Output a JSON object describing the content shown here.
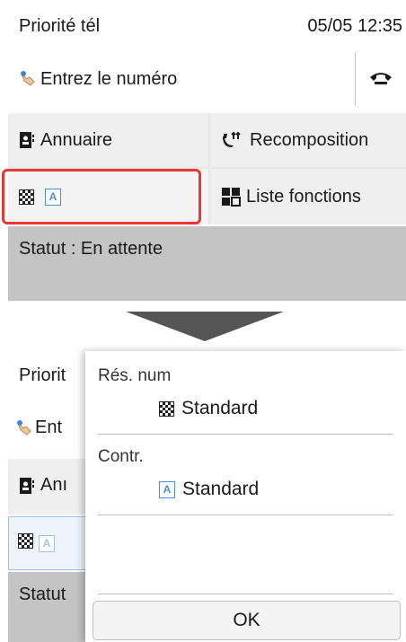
{
  "top_screen": {
    "status_bar": {
      "mode_title": "Priorité tél",
      "datetime": "05/05 12:35"
    },
    "number_input": {
      "placeholder": "Entrez le numéro",
      "icon": "hand-pointer-icon"
    },
    "hook_button": {
      "icon": "phone-hook-icon"
    },
    "buttons": {
      "directory": {
        "label": "Annuaire",
        "icon": "address-book-icon"
      },
      "redial": {
        "label": "Recomposition",
        "icon": "redial-icon"
      },
      "fax_settings": {
        "icons": [
          "resolution-icon",
          "contrast-icon"
        ],
        "contrast_glyph": "A"
      },
      "function_list": {
        "label": "Liste fonctions",
        "icon": "grid-menu-icon"
      }
    },
    "status_panel": {
      "text": "Statut : En attente"
    },
    "highlight_color": "#e53a35"
  },
  "bottom_screen": {
    "background": {
      "mode_title": "Priorit",
      "number_input": "Ent",
      "directory": "Anı",
      "contrast_glyph": "A",
      "status": "Statut"
    },
    "dialog": {
      "resolution": {
        "label": "Rés. num",
        "value": "Standard",
        "icon": "resolution-icon"
      },
      "contrast": {
        "label": "Contr.",
        "value": "Standard",
        "icon": "contrast-icon",
        "glyph": "A"
      },
      "ok_label": "OK"
    }
  }
}
